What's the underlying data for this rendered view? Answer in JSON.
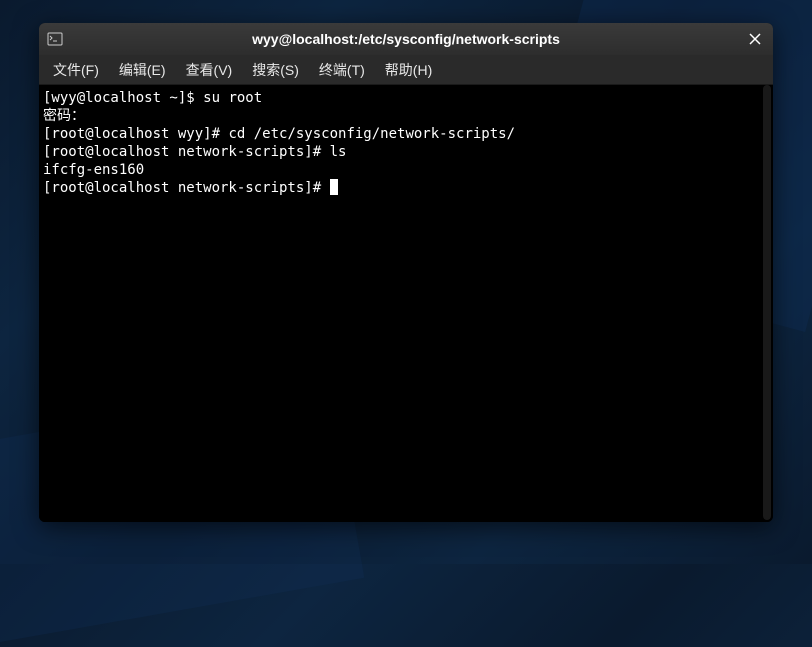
{
  "window": {
    "title": "wyy@localhost:/etc/sysconfig/network-scripts"
  },
  "menu": {
    "file": "文件(F)",
    "edit": "编辑(E)",
    "view": "查看(V)",
    "search": "搜索(S)",
    "terminal": "终端(T)",
    "help": "帮助(H)"
  },
  "terminal": {
    "line1_prompt": "[wyy@localhost ~]$ ",
    "line1_cmd": "su root",
    "line2": "密码：",
    "line3_prompt": "[root@localhost wyy]# ",
    "line3_cmd": "cd /etc/sysconfig/network-scripts/",
    "line4_prompt": "[root@localhost network-scripts]# ",
    "line4_cmd": "ls",
    "line5": "ifcfg-ens160",
    "line6_prompt": "[root@localhost network-scripts]# "
  }
}
